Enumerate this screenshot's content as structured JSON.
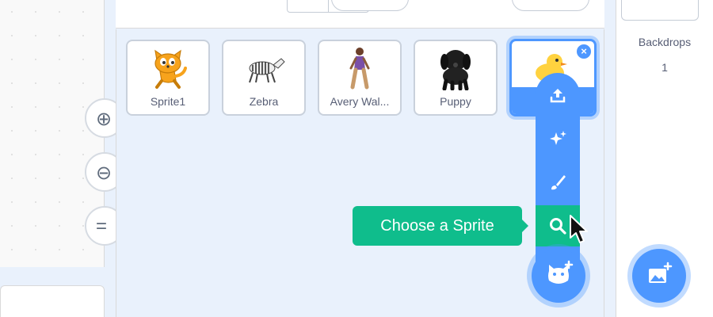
{
  "sprites": [
    {
      "name": "Sprite1",
      "icon": "cat-icon"
    },
    {
      "name": "Zebra",
      "icon": "zebra-icon"
    },
    {
      "name": "Avery Wal...",
      "icon": "person-icon"
    },
    {
      "name": "Puppy",
      "icon": "puppy-icon"
    },
    {
      "name": "",
      "icon": "duck-icon",
      "selected": true
    }
  ],
  "menu": {
    "items": [
      "upload-icon",
      "sparkle-icon",
      "paintbrush-icon",
      "search-icon"
    ],
    "tooltip": "Choose a Sprite"
  },
  "stage": {
    "backdrops_label": "Backdrops",
    "backdrops_count": "1"
  },
  "colors": {
    "accent_blue": "#4d97ff",
    "green": "#0fbd8c",
    "pane_bg": "#e9f1fc"
  }
}
